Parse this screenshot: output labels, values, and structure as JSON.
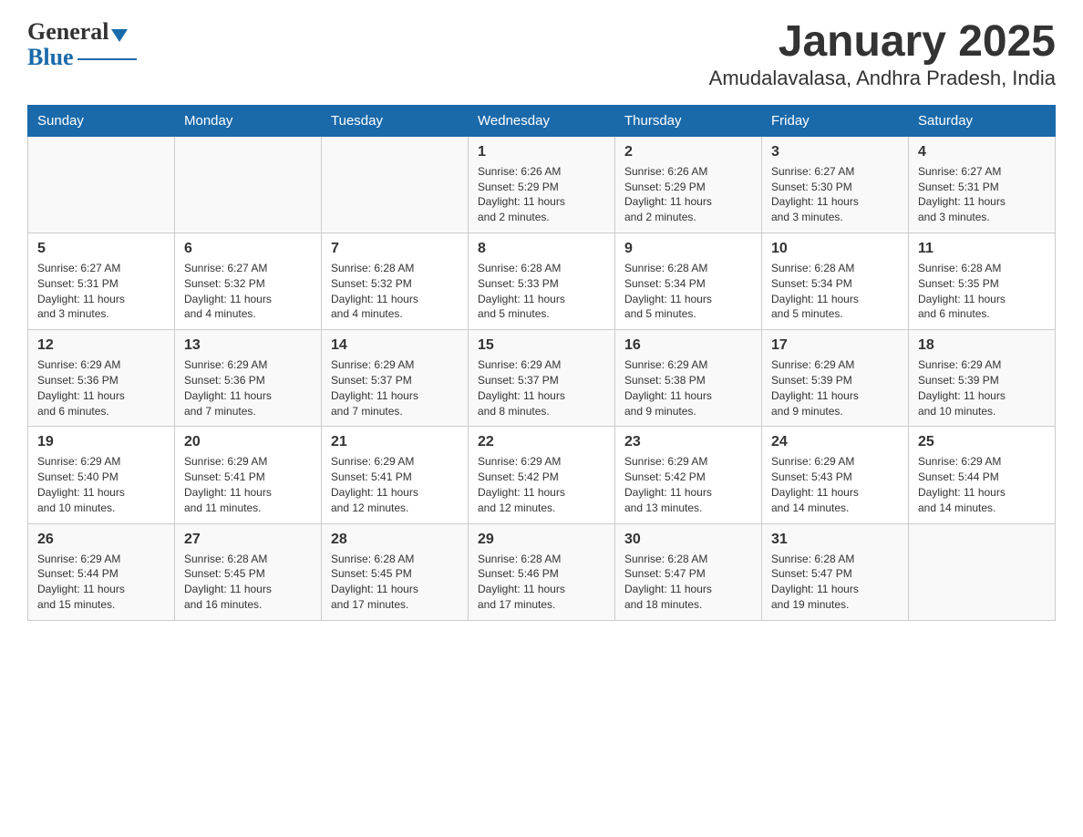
{
  "header": {
    "logo_text_general": "General",
    "logo_text_blue": "Blue",
    "title": "January 2025",
    "subtitle": "Amudalavalasa, Andhra Pradesh, India"
  },
  "weekdays": [
    "Sunday",
    "Monday",
    "Tuesday",
    "Wednesday",
    "Thursday",
    "Friday",
    "Saturday"
  ],
  "weeks": [
    [
      {
        "day": "",
        "info": ""
      },
      {
        "day": "",
        "info": ""
      },
      {
        "day": "",
        "info": ""
      },
      {
        "day": "1",
        "info": "Sunrise: 6:26 AM\nSunset: 5:29 PM\nDaylight: 11 hours\nand 2 minutes."
      },
      {
        "day": "2",
        "info": "Sunrise: 6:26 AM\nSunset: 5:29 PM\nDaylight: 11 hours\nand 2 minutes."
      },
      {
        "day": "3",
        "info": "Sunrise: 6:27 AM\nSunset: 5:30 PM\nDaylight: 11 hours\nand 3 minutes."
      },
      {
        "day": "4",
        "info": "Sunrise: 6:27 AM\nSunset: 5:31 PM\nDaylight: 11 hours\nand 3 minutes."
      }
    ],
    [
      {
        "day": "5",
        "info": "Sunrise: 6:27 AM\nSunset: 5:31 PM\nDaylight: 11 hours\nand 3 minutes."
      },
      {
        "day": "6",
        "info": "Sunrise: 6:27 AM\nSunset: 5:32 PM\nDaylight: 11 hours\nand 4 minutes."
      },
      {
        "day": "7",
        "info": "Sunrise: 6:28 AM\nSunset: 5:32 PM\nDaylight: 11 hours\nand 4 minutes."
      },
      {
        "day": "8",
        "info": "Sunrise: 6:28 AM\nSunset: 5:33 PM\nDaylight: 11 hours\nand 5 minutes."
      },
      {
        "day": "9",
        "info": "Sunrise: 6:28 AM\nSunset: 5:34 PM\nDaylight: 11 hours\nand 5 minutes."
      },
      {
        "day": "10",
        "info": "Sunrise: 6:28 AM\nSunset: 5:34 PM\nDaylight: 11 hours\nand 5 minutes."
      },
      {
        "day": "11",
        "info": "Sunrise: 6:28 AM\nSunset: 5:35 PM\nDaylight: 11 hours\nand 6 minutes."
      }
    ],
    [
      {
        "day": "12",
        "info": "Sunrise: 6:29 AM\nSunset: 5:36 PM\nDaylight: 11 hours\nand 6 minutes."
      },
      {
        "day": "13",
        "info": "Sunrise: 6:29 AM\nSunset: 5:36 PM\nDaylight: 11 hours\nand 7 minutes."
      },
      {
        "day": "14",
        "info": "Sunrise: 6:29 AM\nSunset: 5:37 PM\nDaylight: 11 hours\nand 7 minutes."
      },
      {
        "day": "15",
        "info": "Sunrise: 6:29 AM\nSunset: 5:37 PM\nDaylight: 11 hours\nand 8 minutes."
      },
      {
        "day": "16",
        "info": "Sunrise: 6:29 AM\nSunset: 5:38 PM\nDaylight: 11 hours\nand 9 minutes."
      },
      {
        "day": "17",
        "info": "Sunrise: 6:29 AM\nSunset: 5:39 PM\nDaylight: 11 hours\nand 9 minutes."
      },
      {
        "day": "18",
        "info": "Sunrise: 6:29 AM\nSunset: 5:39 PM\nDaylight: 11 hours\nand 10 minutes."
      }
    ],
    [
      {
        "day": "19",
        "info": "Sunrise: 6:29 AM\nSunset: 5:40 PM\nDaylight: 11 hours\nand 10 minutes."
      },
      {
        "day": "20",
        "info": "Sunrise: 6:29 AM\nSunset: 5:41 PM\nDaylight: 11 hours\nand 11 minutes."
      },
      {
        "day": "21",
        "info": "Sunrise: 6:29 AM\nSunset: 5:41 PM\nDaylight: 11 hours\nand 12 minutes."
      },
      {
        "day": "22",
        "info": "Sunrise: 6:29 AM\nSunset: 5:42 PM\nDaylight: 11 hours\nand 12 minutes."
      },
      {
        "day": "23",
        "info": "Sunrise: 6:29 AM\nSunset: 5:42 PM\nDaylight: 11 hours\nand 13 minutes."
      },
      {
        "day": "24",
        "info": "Sunrise: 6:29 AM\nSunset: 5:43 PM\nDaylight: 11 hours\nand 14 minutes."
      },
      {
        "day": "25",
        "info": "Sunrise: 6:29 AM\nSunset: 5:44 PM\nDaylight: 11 hours\nand 14 minutes."
      }
    ],
    [
      {
        "day": "26",
        "info": "Sunrise: 6:29 AM\nSunset: 5:44 PM\nDaylight: 11 hours\nand 15 minutes."
      },
      {
        "day": "27",
        "info": "Sunrise: 6:28 AM\nSunset: 5:45 PM\nDaylight: 11 hours\nand 16 minutes."
      },
      {
        "day": "28",
        "info": "Sunrise: 6:28 AM\nSunset: 5:45 PM\nDaylight: 11 hours\nand 17 minutes."
      },
      {
        "day": "29",
        "info": "Sunrise: 6:28 AM\nSunset: 5:46 PM\nDaylight: 11 hours\nand 17 minutes."
      },
      {
        "day": "30",
        "info": "Sunrise: 6:28 AM\nSunset: 5:47 PM\nDaylight: 11 hours\nand 18 minutes."
      },
      {
        "day": "31",
        "info": "Sunrise: 6:28 AM\nSunset: 5:47 PM\nDaylight: 11 hours\nand 19 minutes."
      },
      {
        "day": "",
        "info": ""
      }
    ]
  ]
}
